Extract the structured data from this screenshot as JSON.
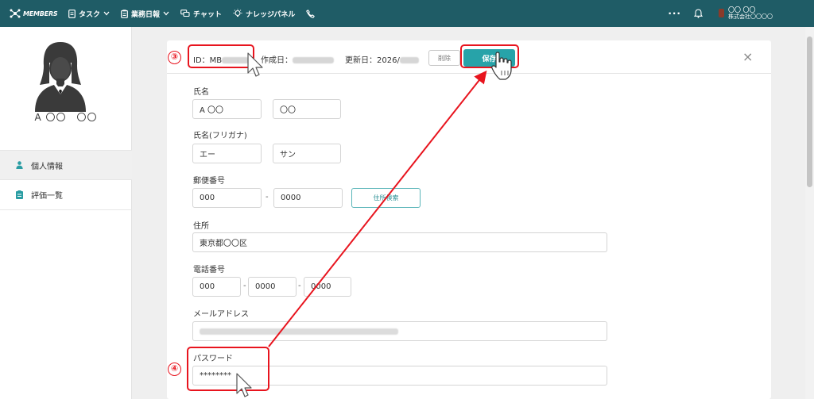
{
  "app": {
    "logo_text": "MEMBERS"
  },
  "nav": {
    "items": [
      {
        "label": "タスク",
        "icon": "document-icon",
        "dropdown": true
      },
      {
        "label": "業務日報",
        "icon": "clipboard-icon",
        "dropdown": true
      },
      {
        "label": "チャット",
        "icon": "chat-icon",
        "dropdown": false
      },
      {
        "label": "ナレッジパネル",
        "icon": "lightbulb-icon",
        "dropdown": false
      },
      {
        "label": "",
        "icon": "phone-icon",
        "dropdown": false
      }
    ],
    "more": "···",
    "user_name": "〇〇 〇〇",
    "user_company": "株式会社〇〇〇〇"
  },
  "sidebar": {
    "profile_name": "A 〇〇　〇〇",
    "items": [
      {
        "label": "個人情報",
        "icon": "person-icon",
        "active": true
      },
      {
        "label": "評価一覧",
        "icon": "list-icon",
        "active": false
      }
    ]
  },
  "header": {
    "id_label": "ID：MB",
    "created_label": "作成日：",
    "updated_label": "更新日：2026/",
    "delete_label": "削除",
    "save_label": "保存"
  },
  "form": {
    "name_label": "氏名",
    "last_name": "A 〇〇",
    "first_name": "〇〇",
    "kana_label": "氏名(フリガナ)",
    "last_kana": "エー",
    "first_kana": "サン",
    "zip_label": "郵便番号",
    "zip1": "000",
    "zip_sep": "-",
    "zip2": "0000",
    "address_search_label": "住所検索",
    "address_label": "住所",
    "address": "東京都〇〇区",
    "phone_label": "電話番号",
    "phone1": "000",
    "phone_sep": "-",
    "phone2": "0000",
    "phone3": "0000",
    "email_label": "メールアドレス",
    "password_label": "パスワード",
    "password": "********"
  },
  "annotations": {
    "step3": "③",
    "step4": "④",
    "color": "#e8141e"
  },
  "colors": {
    "topbar": "#1f5c66",
    "accent": "#27a3a9",
    "annotation": "#e8141e"
  }
}
